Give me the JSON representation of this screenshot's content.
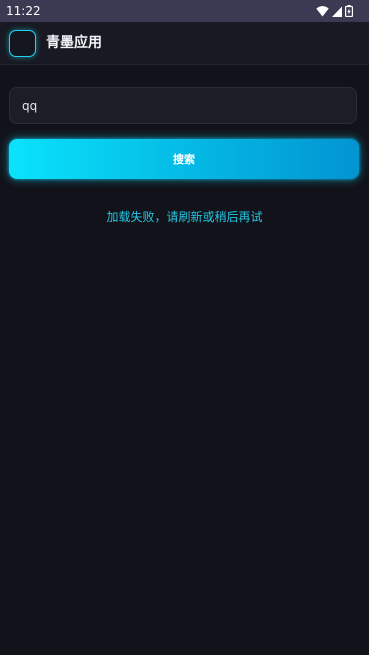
{
  "status_bar": {
    "time": "11:22",
    "icons": [
      "wifi-icon",
      "signal-icon",
      "battery-icon"
    ]
  },
  "app_bar": {
    "title": "青墨应用",
    "logo_icon": "app-logo-icon"
  },
  "search": {
    "value": "qq",
    "button_label": "搜索"
  },
  "message": {
    "error": "加载失败，请刷新或稍后再试"
  },
  "colors": {
    "background": "#12131a",
    "status_bar": "#3a3b52",
    "app_bar": "#181922",
    "accent": "#0ae3fb",
    "accent_dark": "#0394d2",
    "error_text": "#22c6e4"
  }
}
